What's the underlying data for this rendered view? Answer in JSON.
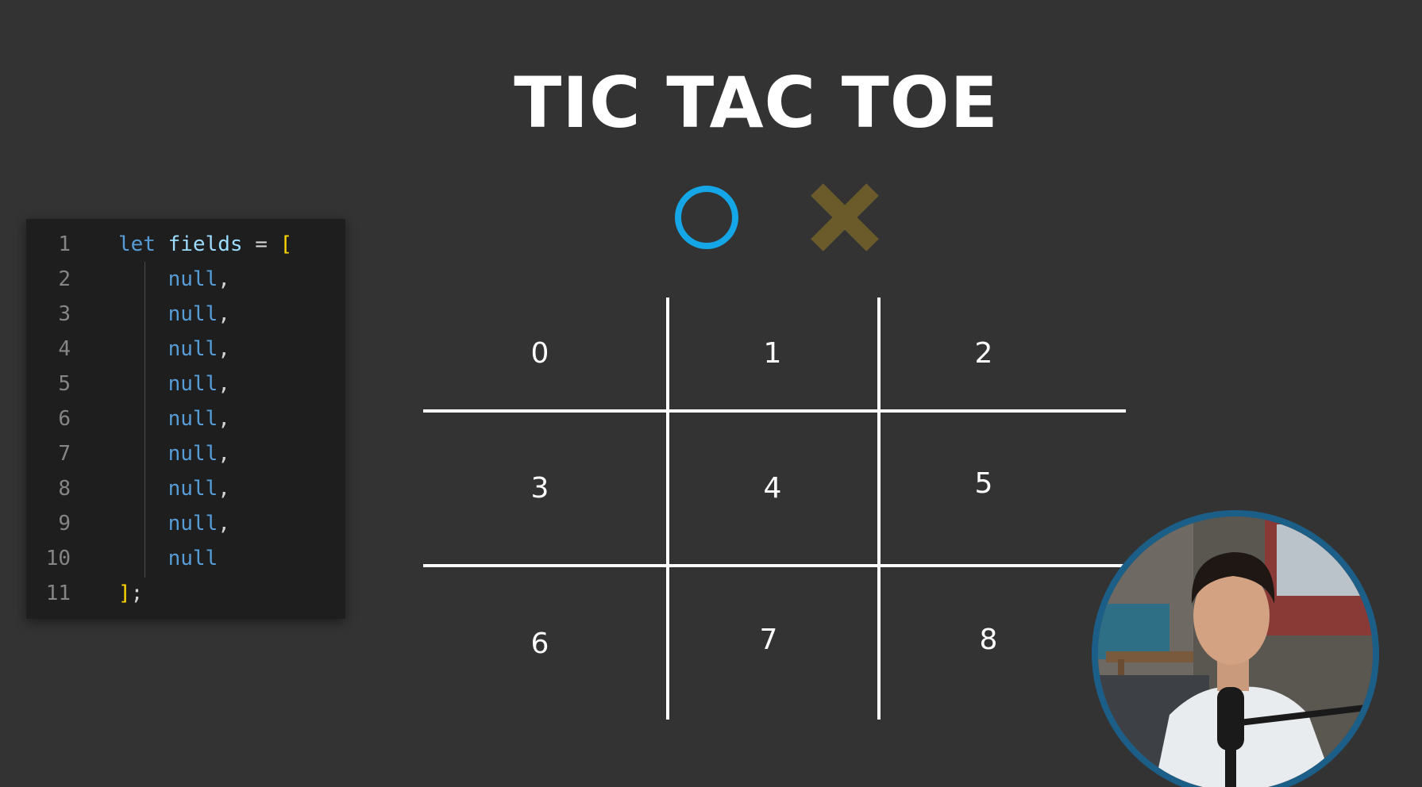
{
  "title": "TIC TAC TOE",
  "players": {
    "circle": {
      "icon": "circle-icon",
      "color": "#14a6e6"
    },
    "cross": {
      "icon": "cross-icon",
      "color": "#6b5a2a"
    }
  },
  "code": {
    "lines": [
      {
        "no": "1",
        "tokens": [
          [
            "kw",
            "let"
          ],
          [
            "op",
            " "
          ],
          [
            "var",
            "fields"
          ],
          [
            "op",
            " = "
          ],
          [
            "bracket",
            "["
          ]
        ]
      },
      {
        "no": "2",
        "tokens": [
          [
            "op",
            "    "
          ],
          [
            "kw",
            "null"
          ],
          [
            "punct",
            ","
          ]
        ]
      },
      {
        "no": "3",
        "tokens": [
          [
            "op",
            "    "
          ],
          [
            "kw",
            "null"
          ],
          [
            "punct",
            ","
          ]
        ]
      },
      {
        "no": "4",
        "tokens": [
          [
            "op",
            "    "
          ],
          [
            "kw",
            "null"
          ],
          [
            "punct",
            ","
          ]
        ]
      },
      {
        "no": "5",
        "tokens": [
          [
            "op",
            "    "
          ],
          [
            "kw",
            "null"
          ],
          [
            "punct",
            ","
          ]
        ]
      },
      {
        "no": "6",
        "tokens": [
          [
            "op",
            "    "
          ],
          [
            "kw",
            "null"
          ],
          [
            "punct",
            ","
          ]
        ]
      },
      {
        "no": "7",
        "tokens": [
          [
            "op",
            "    "
          ],
          [
            "kw",
            "null"
          ],
          [
            "punct",
            ","
          ]
        ]
      },
      {
        "no": "8",
        "tokens": [
          [
            "op",
            "    "
          ],
          [
            "kw",
            "null"
          ],
          [
            "punct",
            ","
          ]
        ]
      },
      {
        "no": "9",
        "tokens": [
          [
            "op",
            "    "
          ],
          [
            "kw",
            "null"
          ],
          [
            "punct",
            ","
          ]
        ]
      },
      {
        "no": "10",
        "tokens": [
          [
            "op",
            "    "
          ],
          [
            "kw",
            "null"
          ]
        ]
      },
      {
        "no": "11",
        "tokens": [
          [
            "bracket",
            "]"
          ],
          [
            "punct",
            ";"
          ]
        ]
      }
    ]
  },
  "board": {
    "cells": [
      "0",
      "1",
      "2",
      "3",
      "4",
      "5",
      "6",
      "7",
      "8"
    ]
  },
  "webcam": {
    "icon": "presenter-video-icon",
    "border_color": "#1b5e88"
  }
}
